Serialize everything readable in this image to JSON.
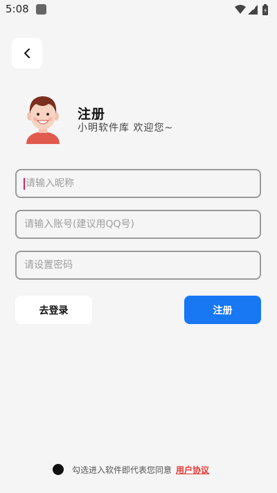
{
  "status_bar": {
    "time": "5:08"
  },
  "header": {
    "title": "注册",
    "welcome": "小明软件库 欢迎您~"
  },
  "form": {
    "nickname_placeholder": "请输入昵称",
    "account_placeholder": "请输入账号(建议用QQ号)",
    "password_placeholder": "请设置密码"
  },
  "buttons": {
    "login_label": "去登录",
    "register_label": "注册"
  },
  "agreement": {
    "text": "勾选进入软件即代表您同意",
    "link_label": "用户协议"
  },
  "colors": {
    "accent": "#1877f2",
    "link": "#e53935",
    "caret": "#d81b60",
    "background": "#f5f5f5"
  },
  "icons": {
    "back": "chevron-left-icon",
    "wifi": "wifi-icon",
    "signal": "signal-icon",
    "battery": "battery-icon"
  }
}
